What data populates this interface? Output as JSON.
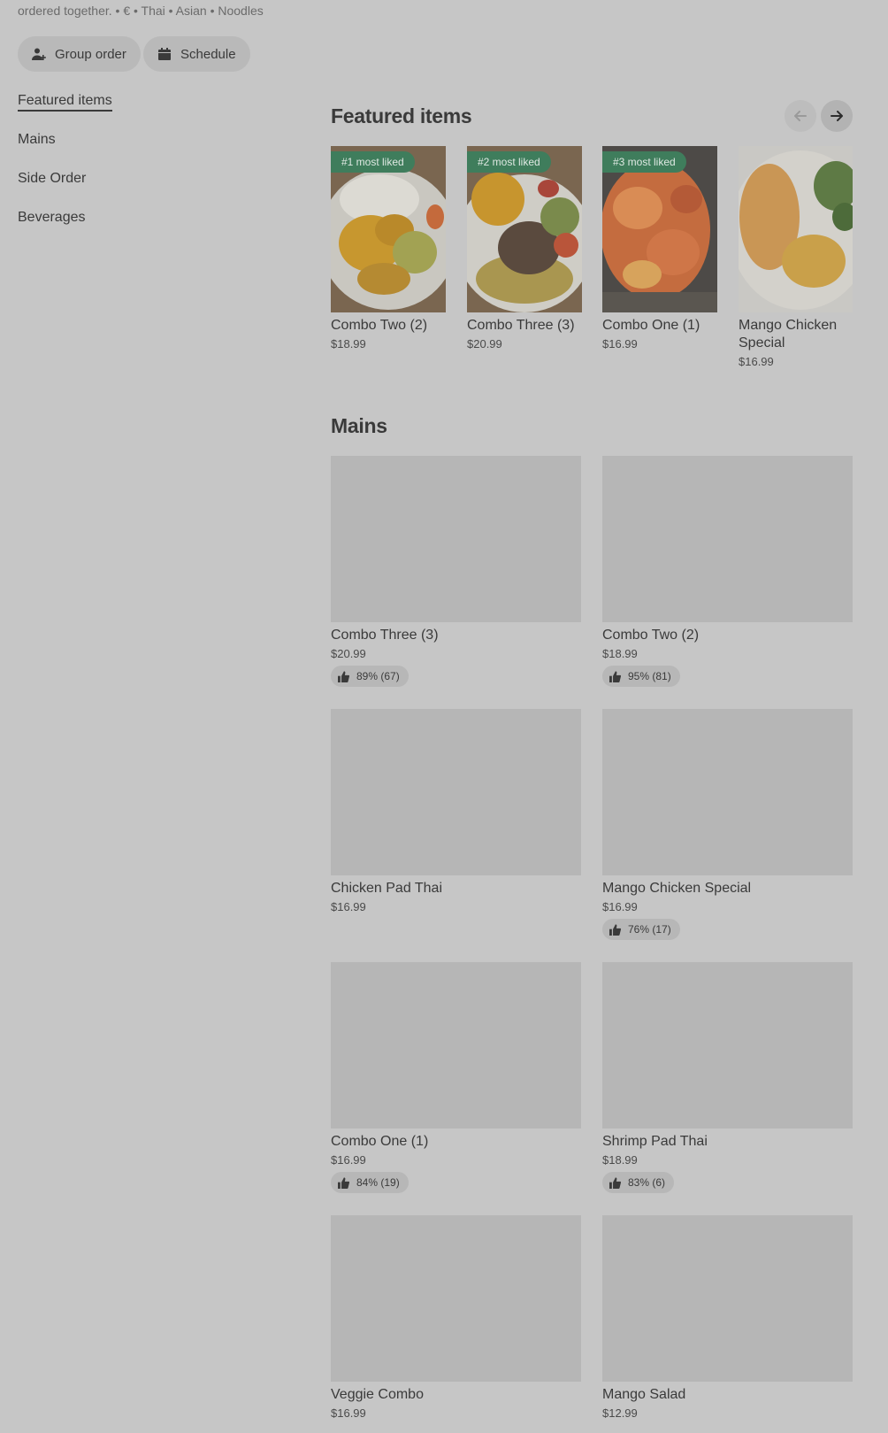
{
  "store": {
    "meta_line": "ordered together. • € • Thai • Asian • Noodles"
  },
  "actions": {
    "group_order": "Group order",
    "schedule": "Schedule"
  },
  "nav": {
    "items": [
      {
        "label": "Featured items",
        "active": true
      },
      {
        "label": "Mains",
        "active": false
      },
      {
        "label": "Side Order",
        "active": false
      },
      {
        "label": "Beverages",
        "active": false
      }
    ]
  },
  "featured": {
    "title": "Featured items",
    "items": [
      {
        "name": "Combo Two (2)",
        "price": "$18.99",
        "badge": "#1 most liked"
      },
      {
        "name": "Combo Three (3)",
        "price": "$20.99",
        "badge": "#2 most liked"
      },
      {
        "name": "Combo One (1)",
        "price": "$16.99",
        "badge": "#3 most liked"
      },
      {
        "name": "Mango Chicken Special",
        "price": "$16.99",
        "badge": ""
      }
    ]
  },
  "mains": {
    "title": "Mains",
    "items": [
      {
        "name": "Combo Three (3)",
        "price": "$20.99",
        "rating": "89% (67)"
      },
      {
        "name": "Combo Two (2)",
        "price": "$18.99",
        "rating": "95% (81)"
      },
      {
        "name": "Chicken Pad Thai",
        "price": "$16.99",
        "rating": ""
      },
      {
        "name": "Mango Chicken Special",
        "price": "$16.99",
        "rating": "76% (17)"
      },
      {
        "name": "Combo One (1)",
        "price": "$16.99",
        "rating": "84% (19)"
      },
      {
        "name": "Shrimp Pad Thai",
        "price": "$18.99",
        "rating": "83% (6)"
      },
      {
        "name": "Veggie Combo",
        "price": "$16.99",
        "rating": ""
      },
      {
        "name": "Mango Salad",
        "price": "$12.99",
        "rating": ""
      }
    ]
  },
  "icons": {
    "group_order": "person-plus-icon",
    "schedule": "calendar-icon",
    "prev": "arrow-left-icon",
    "next": "arrow-right-icon",
    "rating": "thumbs-up-icon"
  },
  "colors": {
    "badge": "#3f7d5c",
    "overlay_background": "#c6c6c6"
  }
}
